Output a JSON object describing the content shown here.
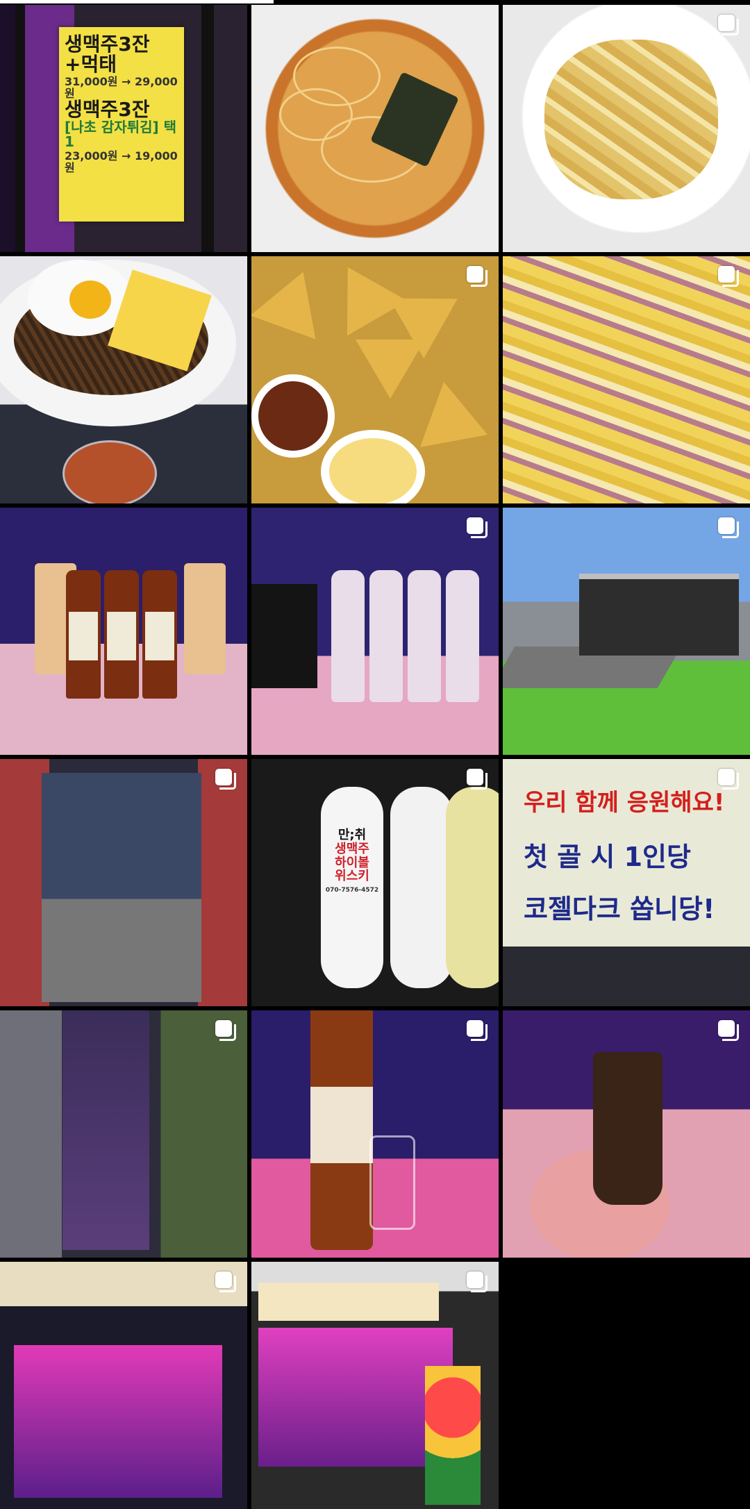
{
  "progress": 0.365,
  "icon_color": "#ffffff",
  "posts": [
    {
      "id": "menu-sign",
      "multi": false,
      "text": [
        "생맥주3잔",
        "+먹태",
        "31,000원 → 29,000원",
        "생맥주3잔",
        "[나초 감자튀김] 택1",
        "23,000원 → 19,000원"
      ]
    },
    {
      "id": "ramen",
      "multi": false
    },
    {
      "id": "cream-pasta",
      "multi": true
    },
    {
      "id": "jjapaguri",
      "multi": false
    },
    {
      "id": "nachos",
      "multi": true
    },
    {
      "id": "cheese-fries",
      "multi": true
    },
    {
      "id": "balvenie-whisky",
      "multi": false
    },
    {
      "id": "soju-bottles",
      "multi": true
    },
    {
      "id": "storefront-lawn",
      "multi": true
    },
    {
      "id": "entrance-door",
      "multi": true
    },
    {
      "id": "outdoor-banners",
      "multi": true,
      "text": [
        "만;취",
        "생맥주",
        "하이볼",
        "위스키",
        "070-7576-4572"
      ]
    },
    {
      "id": "window-sign",
      "multi": true,
      "text": [
        "우리 함께 응원해요!",
        "첫 골 시 1인당",
        "코젤다크 쏩니당!"
      ]
    },
    {
      "id": "standee",
      "multi": true
    },
    {
      "id": "glenfiddich",
      "multi": true
    },
    {
      "id": "kozel-dark",
      "multi": true
    },
    {
      "id": "night-exterior",
      "multi": true
    },
    {
      "id": "day-exterior",
      "multi": true
    }
  ]
}
